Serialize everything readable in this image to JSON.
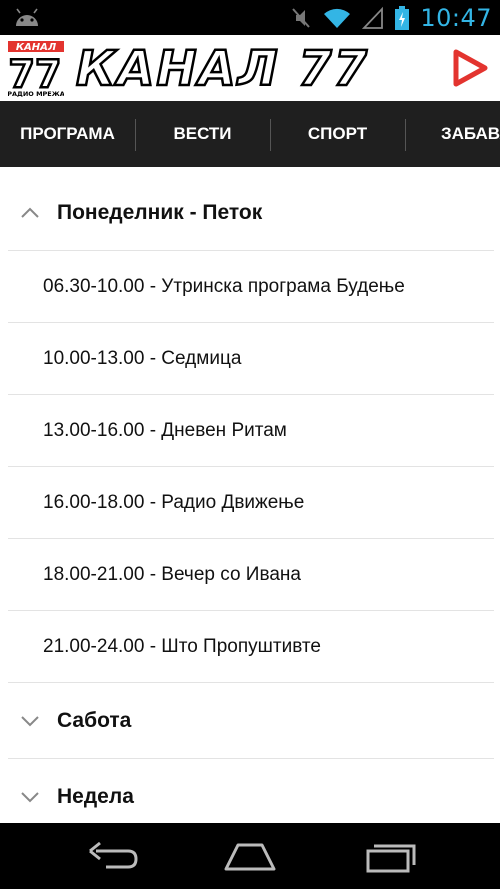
{
  "status_bar": {
    "time": "10:47",
    "icons": [
      "android-icon",
      "mute-icon",
      "wifi-icon",
      "signal-icon",
      "battery-charging-icon"
    ]
  },
  "app_bar": {
    "logo_badge_top": "КАНАЛ",
    "logo_badge_number": "77",
    "logo_badge_bottom": "РАДИО МРЕЖА",
    "title": "КАНАЛ 77",
    "play_icon": "play-icon",
    "accent_color": "#e3342f"
  },
  "tabs": [
    {
      "label": "ПРОГРАМА",
      "selected": true
    },
    {
      "label": "ВЕСТИ",
      "selected": false
    },
    {
      "label": "СПОРТ",
      "selected": false
    },
    {
      "label": "ЗАБАВА",
      "selected": false
    }
  ],
  "schedule": {
    "groups": [
      {
        "title": "Понеделник - Петок",
        "expanded": true,
        "items": [
          "06.30-10.00 - Утринска програма Будење",
          "10.00-13.00 - Седмица",
          "13.00-16.00 - Дневен Ритам",
          "16.00-18.00 - Радио Движење",
          "18.00-21.00 - Вечер со Ивана",
          "21.00-24.00 - Што Пропуштивте"
        ]
      },
      {
        "title": "Сабота",
        "expanded": false,
        "items": []
      },
      {
        "title": "Недела",
        "expanded": false,
        "items": []
      }
    ]
  },
  "nav_bar": {
    "buttons": [
      "back-icon",
      "home-icon",
      "recent-apps-icon"
    ]
  }
}
